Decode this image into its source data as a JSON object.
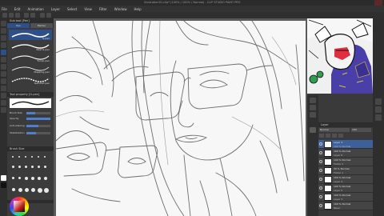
{
  "window": {
    "title": "illustration01.clip* (100% / 100% / Normal) - CLIP STUDIO PAINT PRO"
  },
  "menu": [
    "File",
    "Edit",
    "Animation",
    "Layer",
    "Select",
    "View",
    "Filter",
    "Window",
    "Help"
  ],
  "subtool_panel": {
    "header": "Sub tool [Pen]",
    "tabs": [
      "Pen",
      "Marker"
    ],
    "brushes": [
      {
        "label": "G-pen"
      },
      {
        "label": "Real G-pen"
      },
      {
        "label": "Turnip pen"
      },
      {
        "label": "Mapping pen"
      },
      {
        "label": "Textured pen"
      }
    ]
  },
  "tool_property": {
    "header": "Tool property [G-pen]",
    "rows": [
      {
        "label": "Brush Size",
        "value": 0.35
      },
      {
        "label": "Opacity",
        "value": 1.0
      },
      {
        "label": "Anti-aliasing",
        "value": 0.5
      },
      {
        "label": "Stabilization",
        "value": 0.4
      }
    ]
  },
  "brush_size_panel": {
    "header": "Brush Size"
  },
  "layer_panel": {
    "header": "Layer",
    "blend_mode": "Normal",
    "opacity": "100",
    "layers": [
      {
        "name": "Layer 3",
        "mode": "100 % Normal",
        "selected": true
      },
      {
        "name": "100 % Normal",
        "mode": "Layer 8",
        "selected": false
      },
      {
        "name": "100 % Normal",
        "mode": "Folder 2",
        "selected": false
      },
      {
        "name": "30 % Normal",
        "mode": "Folder 1",
        "selected": false
      },
      {
        "name": "100 % Normal",
        "mode": "Layer 4",
        "selected": false
      },
      {
        "name": "100 % Normal",
        "mode": "Layer 5",
        "selected": false
      },
      {
        "name": "100 % Normal",
        "mode": "Layer 2",
        "selected": false
      },
      {
        "name": "100 % Normal",
        "mode": "Paper",
        "selected": false
      }
    ]
  },
  "colors": {
    "accent": "#2d4f8a",
    "panel": "#3a3a3a",
    "canvas": "#f7f7f7"
  }
}
